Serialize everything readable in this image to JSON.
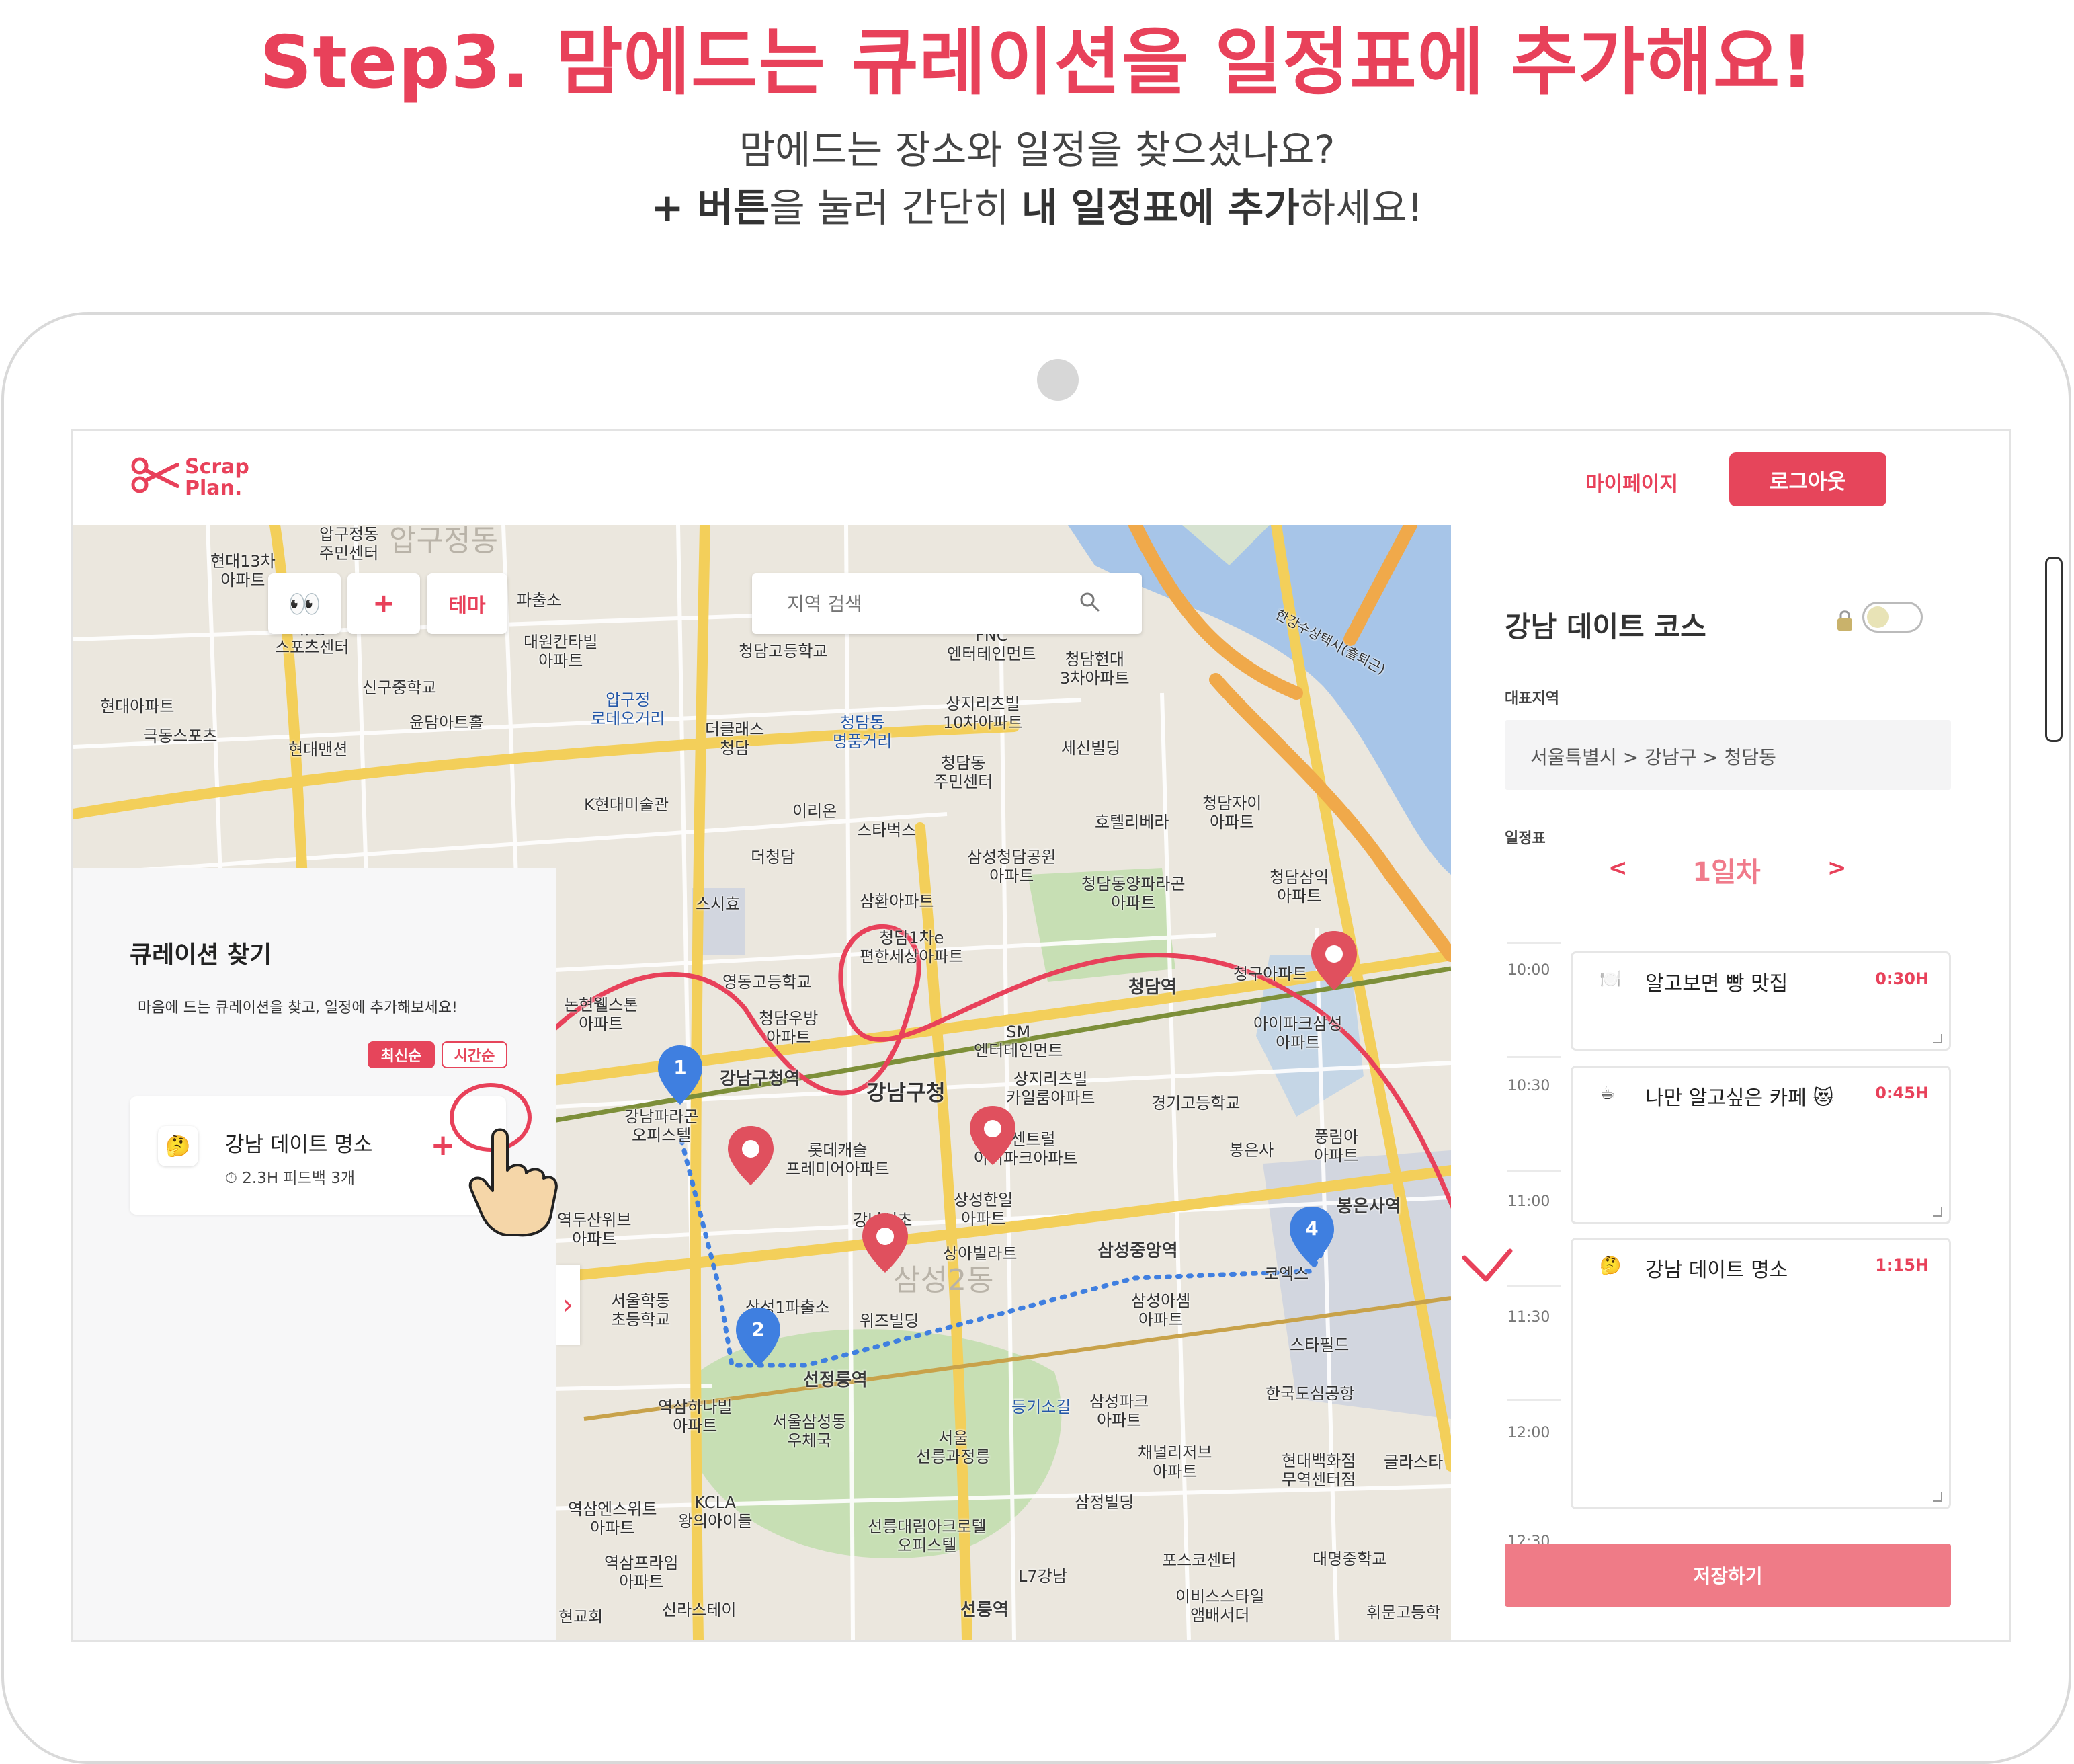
{
  "headline": "Step3. 맘에드는 큐레이션을 일정표에 추가해요!",
  "sub": {
    "line1": "맘에드는 장소와 일정을 찾으셨나요?",
    "line2_bold1": "+ 버튼",
    "line2_text1": "을 눌러 간단히 ",
    "line2_bold2": "내 일정표에 추가",
    "line2_text2": "하세요!"
  },
  "app": {
    "logo_line1": "Scrap",
    "logo_line2": "Plan.",
    "mypage": "마이페이지",
    "logout": "로그아웃"
  },
  "map": {
    "toolbar": {
      "eyes": "👀",
      "plus": "+",
      "theme": "테마"
    },
    "search_placeholder": "지역 검색",
    "pins": [
      "1",
      "2",
      "4"
    ],
    "labels": {
      "l1": "압구정동\n주민센터",
      "l2": "압구정동",
      "l3": "현대13차\n아파트",
      "l4": "대원칸타빌\n아파트",
      "l5": "청담고등학교",
      "l6": "FNC\n엔터테인먼트",
      "l7": "청담현대\n3차아파트",
      "l8": "신구중학교",
      "l9": "윤담아트홀",
      "l10": "압구정\n로데오거리",
      "l11": "더클래스\n청담",
      "l12": "청담동\n명품거리",
      "l13": "상지리츠빌\n10차아파트",
      "l14": "세신빌딩",
      "l15": "청담동\n주민센터",
      "l16": "K현대미술관",
      "l17": "이리온",
      "l18": "스타벅스",
      "l19": "호텔리베라",
      "l20": "청담자이\n아파트",
      "l21": "극동스포츠",
      "l22": "현대아파트",
      "l23": "현대맨션",
      "l24": "더청담",
      "l25": "삼성청담공원\n아파트",
      "l26": "청담삼익\n아파트",
      "l27": "스시효",
      "l28": "삼환아파트",
      "l29": "청담동양파라곤\n아파트",
      "l30": "청담1차e\n편한세상아파트",
      "l31": "영동고등학교",
      "l32": "청담역",
      "l33": "청구아파트",
      "l34": "청담우방\n아파트",
      "l35": "SM\n엔터테인먼트",
      "l36": "아이파크삼성\n아파트",
      "l37": "강남구청역",
      "l38": "강남구청",
      "l39": "상지리츠빌\n카일룸아파트",
      "l40": "경기고등학교",
      "l41": "강남파라곤\n오피스텔",
      "l42": "롯데캐슬\n프레미어아파트",
      "l43": "동센트럴\n아이파크아파트",
      "l44": "봉은사",
      "l45": "풍림아\n아파트",
      "l46": "봉은사역",
      "l47": "상성한일\n아파트",
      "l48": "삼성중앙역",
      "l49": "상아빌라트",
      "l50": "삼성2동",
      "l51": "코엑스",
      "l52": "서울학동\n초등학교",
      "l53": "삼성1파출소",
      "l54": "위즈빌딩",
      "l55": "삼성아셈\n아파트",
      "l56": "스타필드",
      "l57": "선정릉역",
      "l58": "등기소길",
      "l59": "삼성파크\n아파트",
      "l60": "한국도심공항",
      "l61": "역삼하나빌\n아파트",
      "l62": "서울삼성동\n우체국",
      "l63": "서울\n선릉과정릉",
      "l64": "채널리저브\n아파트",
      "l65": "현대백화점\n무역센터점",
      "l66": "글라스타",
      "l67": "KCLA\n왕의아이들",
      "l68": "역삼엔스위트\n아파트",
      "l69": "선릉대림아크로텔\n오피스텔",
      "l70": "삼정빌딩",
      "l71": "포스코센터",
      "l72": "대명중학교",
      "l73": "역삼프라임\n아파트",
      "l74": "L7강남",
      "l75": "신라스테이",
      "l76": "선릉역",
      "l77": "이비스스타일\n앰배서더",
      "l78": "휘문고등학",
      "l79": "현교회",
      "l80": "한강수상택시(출퇴근)",
      "l81": "논현웰스톤\n아파트",
      "l82": "역두산위브\n아파트",
      "l83": "파출소",
      "l84": "유성\n스포츠센터",
      "l85": "강남서초\n교"
    }
  },
  "curation": {
    "title": "큐레이션 찾기",
    "desc": "마음에 드는 큐레이션을 찾고, 일정에 추가해보세요!",
    "sort_recent": "최신순",
    "sort_time": "시간순",
    "card": {
      "emoji": "🤔",
      "name": "강남 데이트 명소",
      "meta": "⏱ 2.3H  피드백 3개",
      "add": "+"
    },
    "toggle": "›"
  },
  "schedule": {
    "title": "강남 데이트 코스",
    "region_label": "대표지역",
    "region_value": "서울특별시 >  강남구 >  청담동",
    "timetable_label": "일정표",
    "prev": "<",
    "day": "1일차",
    "next": ">",
    "times": [
      "10:00",
      "10:30",
      "11:00",
      "11:30",
      "12:00",
      "12:30"
    ],
    "items": [
      {
        "icon": "🍽️",
        "name": "알고보면 빵 맛집",
        "duration": "0:30H"
      },
      {
        "icon": "☕",
        "name": "나만 알고싶은 카페 😻",
        "duration": "0:45H"
      },
      {
        "icon": "🤔",
        "name": "강남 데이트 명소",
        "duration": "1:15H"
      }
    ],
    "save": "저장하기"
  },
  "colors": {
    "accent": "#e8415a",
    "save": "#ef7b87",
    "pin_blue": "#3f7fe0",
    "pin_red": "#e0505e"
  }
}
